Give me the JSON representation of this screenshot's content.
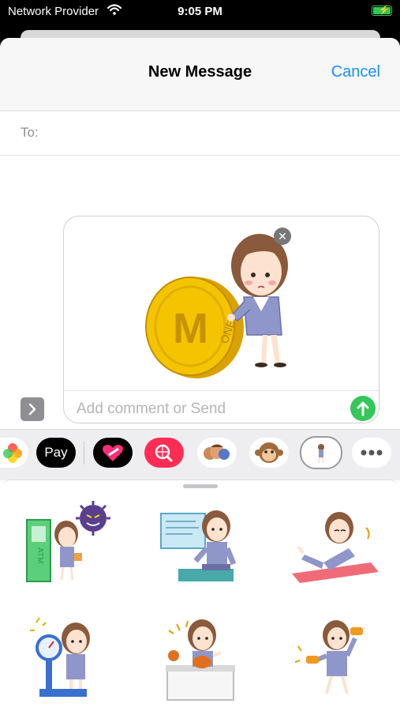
{
  "status_bar": {
    "carrier": "Network Provider",
    "time": "9:05 PM"
  },
  "header": {
    "title": "New Message",
    "cancel_label": "Cancel"
  },
  "recipient": {
    "label": "To:"
  },
  "compose": {
    "placeholder": "Add comment or Send",
    "attached_sticker": "coin-girl-sticker",
    "coin_text": "ONEY"
  },
  "app_drawer": {
    "items": [
      {
        "name": "photos-app-icon"
      },
      {
        "name": "apple-pay-app-icon",
        "label": "Pay"
      },
      {
        "name": "digital-touch-app-icon"
      },
      {
        "name": "web-search-app-icon"
      },
      {
        "name": "memoji-app-icon"
      },
      {
        "name": "animoji-app-icon"
      },
      {
        "name": "sticker-pack-app-icon",
        "selected": true
      },
      {
        "name": "more-apps-icon"
      }
    ]
  },
  "sticker_grid": {
    "items": [
      {
        "name": "atm-virus-sticker",
        "sign_text": "ATM"
      },
      {
        "name": "computer-desk-sticker"
      },
      {
        "name": "relaxing-mat-sticker"
      },
      {
        "name": "weighing-scale-sticker"
      },
      {
        "name": "cooking-counter-sticker"
      },
      {
        "name": "dumbbell-workout-sticker"
      }
    ]
  },
  "colors": {
    "accent": "#1a8cff",
    "send": "#34c759",
    "coin": "#f5c400",
    "suit": "#8f96c9",
    "hair": "#8a5a3c"
  }
}
